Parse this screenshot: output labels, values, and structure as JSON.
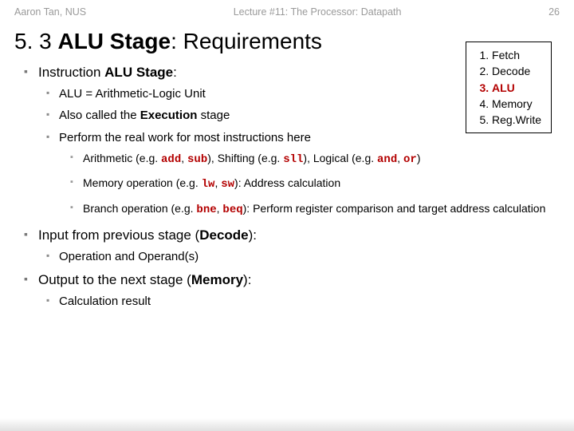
{
  "header": {
    "left": "Aaron Tan, NUS",
    "center": "Lecture #11: The Processor: Datapath",
    "right": "26"
  },
  "title_pre": "5. 3 ",
  "title_bold": "ALU Stage",
  "title_post": ": Requirements",
  "stages": {
    "s1": "Fetch",
    "s2": "Decode",
    "s3": "ALU",
    "s4": "Memory",
    "s5": "Reg.Write"
  },
  "b1_pre": "Instruction ",
  "b1_bold": "ALU Stage",
  "b1_post": ":",
  "b1a": "ALU = Arithmetic-Logic Unit",
  "b1b_pre": "Also called the ",
  "b1b_bold": "Execution",
  "b1b_post": " stage",
  "b1c": "Perform the real work for most instructions here",
  "b1c_i_pre": "Arithmetic (e.g. ",
  "b1c_i_c1": "add",
  "b1c_i_m1": ", ",
  "b1c_i_c2": "sub",
  "b1c_i_m2": "), Shifting (e.g. ",
  "b1c_i_c3": "sll",
  "b1c_i_m3": "), Logical (e.g. ",
  "b1c_i_c4": "and",
  "b1c_i_m4": ", ",
  "b1c_i_c5": "or",
  "b1c_i_post": ")",
  "b1c_ii_pre": "Memory operation (e.g. ",
  "b1c_ii_c1": "lw",
  "b1c_ii_m1": ", ",
  "b1c_ii_c2": "sw",
  "b1c_ii_post": "): Address calculation",
  "b1c_iii_pre": "Branch operation (e.g. ",
  "b1c_iii_c1": "bne",
  "b1c_iii_m1": ", ",
  "b1c_iii_c2": "beq",
  "b1c_iii_post": "): Perform register comparison and target address calculation",
  "b2_pre": "Input from previous stage (",
  "b2_bold": "Decode",
  "b2_post": "):",
  "b2a": "Operation and Operand(s)",
  "b3_pre": "Output to the next stage (",
  "b3_bold": "Memory",
  "b3_post": "):",
  "b3a": "Calculation result"
}
